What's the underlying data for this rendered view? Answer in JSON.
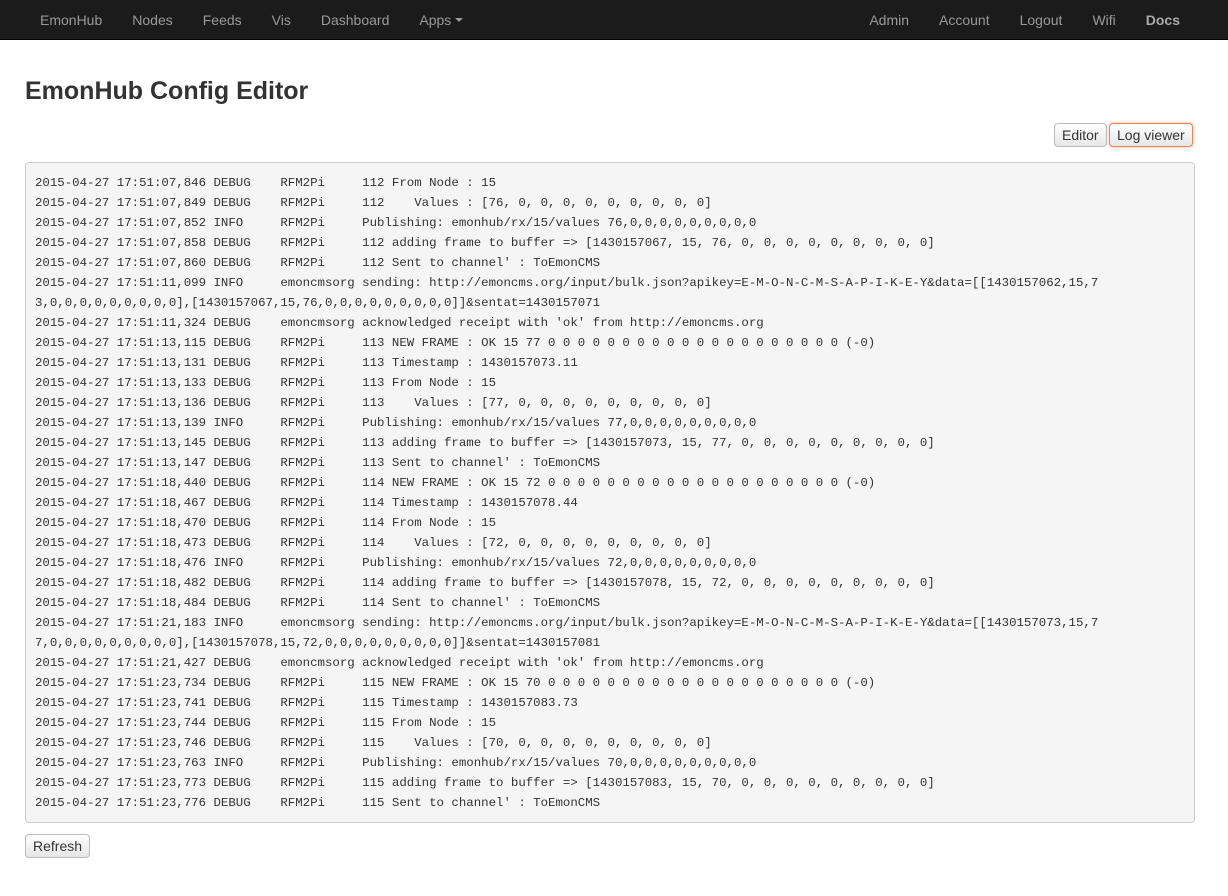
{
  "nav": {
    "left": [
      {
        "label": "EmonHub",
        "name": "nav-emonhub"
      },
      {
        "label": "Nodes",
        "name": "nav-nodes"
      },
      {
        "label": "Feeds",
        "name": "nav-feeds"
      },
      {
        "label": "Vis",
        "name": "nav-vis"
      },
      {
        "label": "Dashboard",
        "name": "nav-dashboard"
      },
      {
        "label": "Apps",
        "name": "nav-apps"
      }
    ],
    "right": [
      {
        "label": "Admin",
        "name": "nav-admin"
      },
      {
        "label": "Account",
        "name": "nav-account"
      },
      {
        "label": "Logout",
        "name": "nav-logout"
      },
      {
        "label": "Wifi",
        "name": "nav-wifi"
      },
      {
        "label": "Docs",
        "name": "nav-docs"
      }
    ]
  },
  "page": {
    "title": "EmonHub Config Editor"
  },
  "buttons": {
    "editor": "Editor",
    "log_viewer": "Log viewer",
    "refresh": "Refresh"
  },
  "log_lines": [
    "2015-04-27 17:51:07,846 DEBUG    RFM2Pi     112 From Node : 15",
    "2015-04-27 17:51:07,849 DEBUG    RFM2Pi     112    Values : [76, 0, 0, 0, 0, 0, 0, 0, 0, 0]",
    "2015-04-27 17:51:07,852 INFO     RFM2Pi     Publishing: emonhub/rx/15/values 76,0,0,0,0,0,0,0,0,0",
    "2015-04-27 17:51:07,858 DEBUG    RFM2Pi     112 adding frame to buffer => [1430157067, 15, 76, 0, 0, 0, 0, 0, 0, 0, 0, 0]",
    "2015-04-27 17:51:07,860 DEBUG    RFM2Pi     112 Sent to channel' : ToEmonCMS",
    "2015-04-27 17:51:11,099 INFO     emoncmsorg sending: http://emoncms.org/input/bulk.json?apikey=E-M-O-N-C-M-S-A-P-I-K-E-Y&data=[[1430157062,15,7",
    "3,0,0,0,0,0,0,0,0,0],[1430157067,15,76,0,0,0,0,0,0,0,0,0]]&sentat=1430157071",
    "2015-04-27 17:51:11,324 DEBUG    emoncmsorg acknowledged receipt with 'ok' from http://emoncms.org",
    "2015-04-27 17:51:13,115 DEBUG    RFM2Pi     113 NEW FRAME : OK 15 77 0 0 0 0 0 0 0 0 0 0 0 0 0 0 0 0 0 0 0 0 (-0)",
    "2015-04-27 17:51:13,131 DEBUG    RFM2Pi     113 Timestamp : 1430157073.11",
    "2015-04-27 17:51:13,133 DEBUG    RFM2Pi     113 From Node : 15",
    "2015-04-27 17:51:13,136 DEBUG    RFM2Pi     113    Values : [77, 0, 0, 0, 0, 0, 0, 0, 0, 0]",
    "2015-04-27 17:51:13,139 INFO     RFM2Pi     Publishing: emonhub/rx/15/values 77,0,0,0,0,0,0,0,0,0",
    "2015-04-27 17:51:13,145 DEBUG    RFM2Pi     113 adding frame to buffer => [1430157073, 15, 77, 0, 0, 0, 0, 0, 0, 0, 0, 0]",
    "2015-04-27 17:51:13,147 DEBUG    RFM2Pi     113 Sent to channel' : ToEmonCMS",
    "2015-04-27 17:51:18,440 DEBUG    RFM2Pi     114 NEW FRAME : OK 15 72 0 0 0 0 0 0 0 0 0 0 0 0 0 0 0 0 0 0 0 0 (-0)",
    "2015-04-27 17:51:18,467 DEBUG    RFM2Pi     114 Timestamp : 1430157078.44",
    "2015-04-27 17:51:18,470 DEBUG    RFM2Pi     114 From Node : 15",
    "2015-04-27 17:51:18,473 DEBUG    RFM2Pi     114    Values : [72, 0, 0, 0, 0, 0, 0, 0, 0, 0]",
    "2015-04-27 17:51:18,476 INFO     RFM2Pi     Publishing: emonhub/rx/15/values 72,0,0,0,0,0,0,0,0,0",
    "2015-04-27 17:51:18,482 DEBUG    RFM2Pi     114 adding frame to buffer => [1430157078, 15, 72, 0, 0, 0, 0, 0, 0, 0, 0, 0]",
    "2015-04-27 17:51:18,484 DEBUG    RFM2Pi     114 Sent to channel' : ToEmonCMS",
    "2015-04-27 17:51:21,183 INFO     emoncmsorg sending: http://emoncms.org/input/bulk.json?apikey=E-M-O-N-C-M-S-A-P-I-K-E-Y&data=[[1430157073,15,7",
    "7,0,0,0,0,0,0,0,0,0],[1430157078,15,72,0,0,0,0,0,0,0,0,0]]&sentat=1430157081",
    "2015-04-27 17:51:21,427 DEBUG    emoncmsorg acknowledged receipt with 'ok' from http://emoncms.org",
    "2015-04-27 17:51:23,734 DEBUG    RFM2Pi     115 NEW FRAME : OK 15 70 0 0 0 0 0 0 0 0 0 0 0 0 0 0 0 0 0 0 0 0 (-0)",
    "2015-04-27 17:51:23,741 DEBUG    RFM2Pi     115 Timestamp : 1430157083.73",
    "2015-04-27 17:51:23,744 DEBUG    RFM2Pi     115 From Node : 15",
    "2015-04-27 17:51:23,746 DEBUG    RFM2Pi     115    Values : [70, 0, 0, 0, 0, 0, 0, 0, 0, 0]",
    "2015-04-27 17:51:23,763 INFO     RFM2Pi     Publishing: emonhub/rx/15/values 70,0,0,0,0,0,0,0,0,0",
    "2015-04-27 17:51:23,773 DEBUG    RFM2Pi     115 adding frame to buffer => [1430157083, 15, 70, 0, 0, 0, 0, 0, 0, 0, 0, 0]",
    "2015-04-27 17:51:23,776 DEBUG    RFM2Pi     115 Sent to channel' : ToEmonCMS"
  ]
}
